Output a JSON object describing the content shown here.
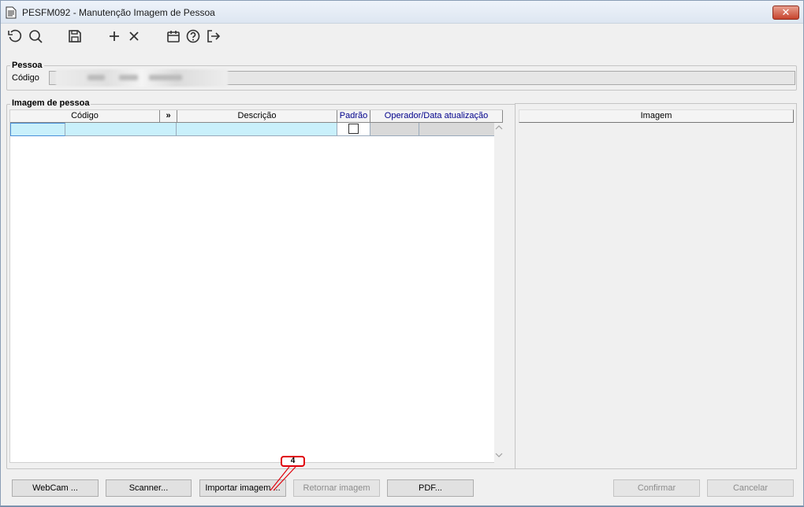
{
  "window": {
    "title": "PESFM092 - Manutenção Imagem de Pessoa",
    "close_label": "✕"
  },
  "toolbar": {
    "items": [
      {
        "name": "refresh",
        "icon": "refresh-icon"
      },
      {
        "name": "search",
        "icon": "search-icon"
      },
      {
        "name": "save",
        "icon": "save-icon"
      },
      {
        "name": "add",
        "icon": "plus-icon"
      },
      {
        "name": "delete",
        "icon": "close-icon"
      },
      {
        "name": "calendar",
        "icon": "calendar-icon"
      },
      {
        "name": "help",
        "icon": "help-icon"
      },
      {
        "name": "exit",
        "icon": "exit-icon"
      }
    ]
  },
  "pessoa": {
    "group_label": "Pessoa",
    "codigo_label": "Código",
    "codigo_value": ""
  },
  "imagem_pessoa": {
    "group_label": "Imagem de pessoa",
    "columns": {
      "codigo": "Código",
      "expand": "»",
      "descricao": "Descrição",
      "padrao": "Padrão",
      "operador": "Operador/Data atualização"
    },
    "rows": [
      {
        "codigo_a": "",
        "codigo_b": "",
        "descricao": "",
        "padrao": false,
        "operador": "",
        "data": ""
      }
    ]
  },
  "image_panel": {
    "header": "Imagem"
  },
  "buttons": {
    "webcam": "WebCam ...",
    "scanner": "Scanner...",
    "importar": "Importar imagem ...",
    "retornar": "Retornar imagem",
    "pdf": "PDF...",
    "confirmar": "Confirmar",
    "cancelar": "Cancelar"
  },
  "callout": {
    "label": "4",
    "color": "#e0000a"
  },
  "colors": {
    "selected_row": "#c9f0fb",
    "header_blue": "#00008b",
    "close_red": "#c7432c"
  }
}
